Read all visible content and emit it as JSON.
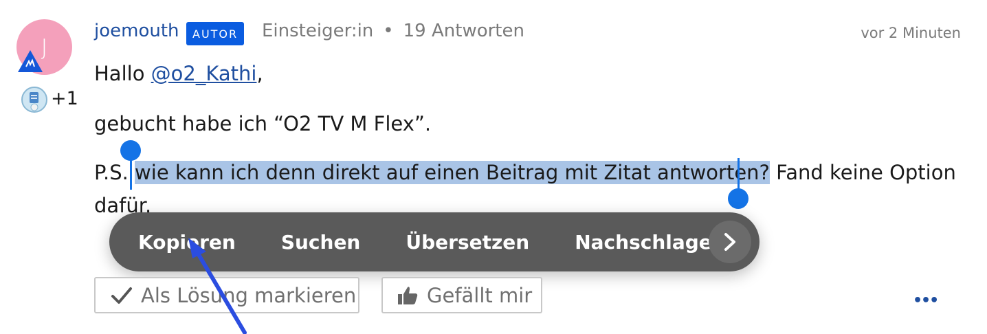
{
  "author": {
    "avatar_initial": "J",
    "avatar_color": "#f4a0bb",
    "username": "joemouth",
    "role_badge": "AUTOR",
    "rank": "Einsteiger:in",
    "separator": "•",
    "replies": "19 Antworten",
    "awards_extra": "+1"
  },
  "post": {
    "timestamp": "vor 2 Minuten",
    "greeting_prefix": "Hallo ",
    "mention": "@o2_Kathi",
    "greeting_suffix": ",",
    "line2": "gebucht habe ich “O2 TV M Flex”.",
    "ps_prefix": "P.S. ",
    "ps_selected": "wie kann ich denn direkt auf einen Beitrag mit Zitat antworten?",
    "ps_rest": " Fand keine Option",
    "ps_line2": "dafür."
  },
  "context_menu": {
    "items": [
      "Kopieren",
      "Suchen",
      "Übersetzen",
      "Nachschlagen"
    ],
    "next_icon": "chevron-right-icon"
  },
  "actions": {
    "solution_label": "Als Lösung markieren",
    "like_label": "Gefällt mir",
    "more_label": "•••"
  },
  "colors": {
    "link": "#1f4fa0",
    "badge": "#0a5ce0",
    "selection": "#a9c4e6",
    "selection_handle": "#1473e6",
    "menu_bg": "#5a5a5a",
    "annotation_arrow": "#2b4de0"
  }
}
